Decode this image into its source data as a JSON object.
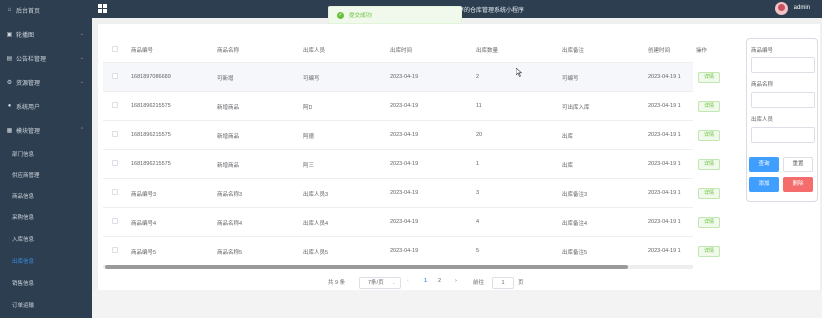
{
  "sidebar": {
    "items": [
      {
        "label": "后台首页",
        "icon": "home-icon"
      },
      {
        "label": "轮播图",
        "icon": "picture-icon"
      },
      {
        "label": "公告栏管理",
        "icon": "notice-icon"
      },
      {
        "label": "资源管理",
        "icon": "gear-icon"
      },
      {
        "label": "系统用户",
        "icon": "user-icon"
      },
      {
        "label": "模块管理",
        "icon": "module-icon"
      }
    ],
    "subitems": [
      "部门信息",
      "供应商管理",
      "商品信息",
      "采购信息",
      "入库信息",
      "出库信息",
      "销售信息",
      "订单运输"
    ]
  },
  "header": {
    "title": "基于微信小程序的仓库管理系统小程序",
    "user": "admin"
  },
  "toast": {
    "text": "提交成功!"
  },
  "table": {
    "columns": [
      "商品编号",
      "商品名称",
      "出库人员",
      "出库时间",
      "出库数量",
      "出库备注",
      "创建时间",
      "操作"
    ],
    "rows": [
      [
        "1681897086689",
        "可新增",
        "可编写",
        "2023-04-19",
        "2",
        "可编写",
        "2023-04-19 1"
      ],
      [
        "1681896215575",
        "新增商品",
        "阿D",
        "2023-04-19",
        "11",
        "可出库入库",
        "2023-04-19 1"
      ],
      [
        "1681896215575",
        "新增商品",
        "阿德",
        "2023-04-19",
        "20",
        "出库",
        "2023-04-19 1"
      ],
      [
        "1681896215575",
        "新增商品",
        "阿三",
        "2023-04-19",
        "1",
        "出库",
        "2023-04-19 1"
      ],
      [
        "商品编号3",
        "商品名称3",
        "出库人员3",
        "2023-04-19",
        "3",
        "出库备注3",
        "2023-04-19 1"
      ],
      [
        "商品编号4",
        "商品名称4",
        "出库人员4",
        "2023-04-19",
        "4",
        "出库备注4",
        "2023-04-19 1"
      ],
      [
        "商品编号5",
        "商品名称5",
        "出库人员5",
        "2023-04-19",
        "5",
        "出库备注5",
        "2023-04-19 1"
      ]
    ],
    "detail_label": "详情"
  },
  "pagination": {
    "total": "共 9 条",
    "page_size": "7条/页",
    "pages": [
      "1",
      "2"
    ],
    "current": "1",
    "goto_label": "前往",
    "goto_value": "1",
    "page_suffix": "页"
  },
  "search": {
    "fields": [
      "商品编号",
      "商品名称",
      "出库人员"
    ],
    "query_label": "查询",
    "reset_label": "重置",
    "add_label": "添加",
    "delete_label": "删除"
  },
  "colors": {
    "sidebar_bg": "#2c3e50",
    "primary": "#409eff",
    "success": "#67c23a",
    "danger": "#f56c6c"
  }
}
